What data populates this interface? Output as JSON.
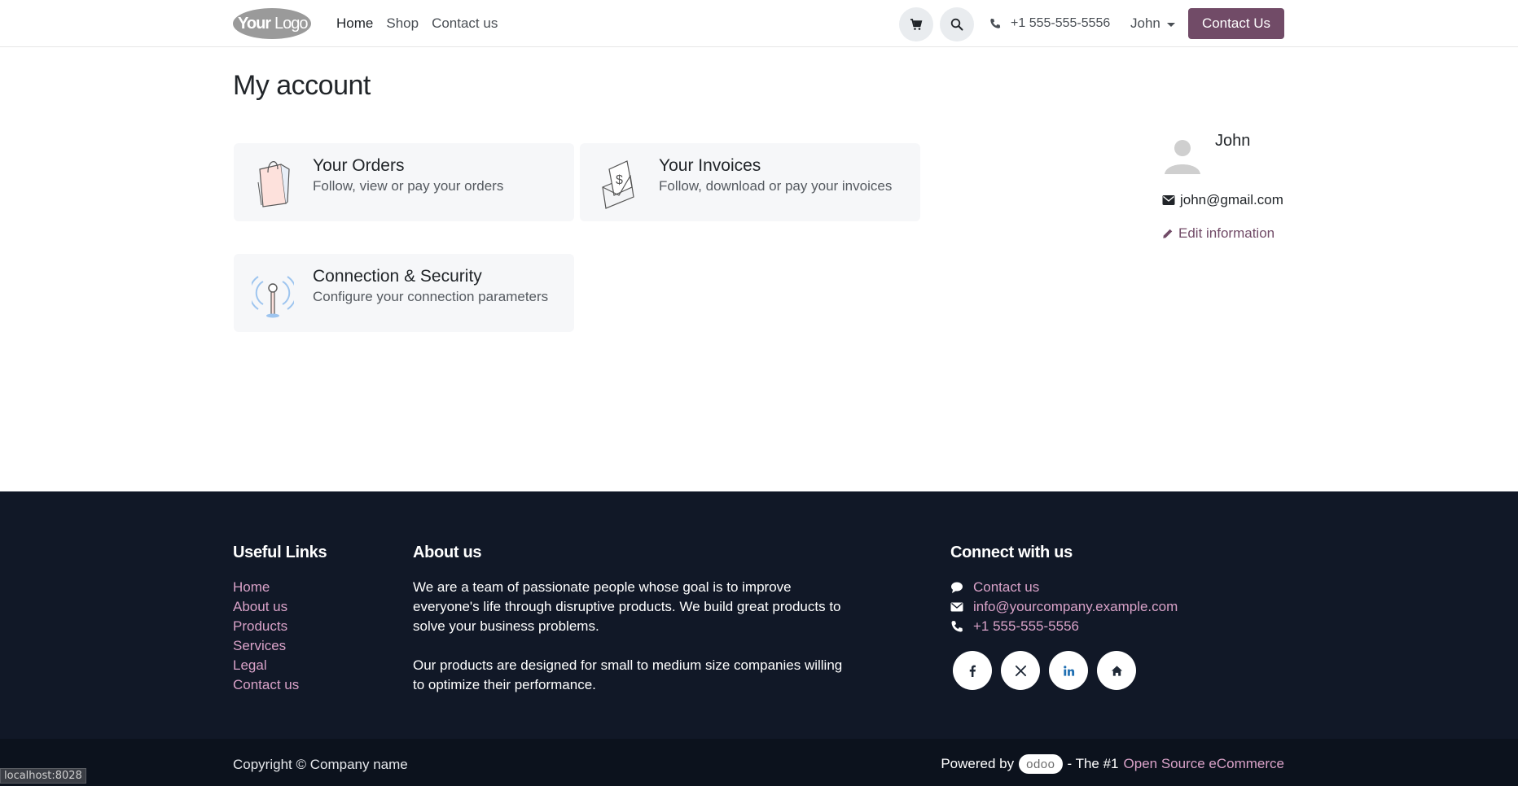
{
  "header": {
    "logo_text": "YourLogo",
    "nav": [
      {
        "label": "Home",
        "active": true
      },
      {
        "label": "Shop",
        "active": false
      },
      {
        "label": "Contact us",
        "active": false
      }
    ],
    "phone": "+1 555-555-5556",
    "user": "John",
    "cta": "Contact Us"
  },
  "main": {
    "title": "My account",
    "cards": [
      {
        "title": "Your Orders",
        "desc": "Follow, view or pay your orders"
      },
      {
        "title": "Your Invoices",
        "desc": "Follow, download or pay your invoices"
      },
      {
        "title": "Connection & Security",
        "desc": "Configure your connection parameters"
      }
    ],
    "profile": {
      "name": "John",
      "email": "john@gmail.com",
      "edit_label": "Edit information"
    }
  },
  "footer": {
    "useful_links_title": "Useful Links",
    "useful_links": [
      "Home",
      "About us",
      "Products",
      "Services",
      "Legal",
      "Contact us"
    ],
    "about_title": "About us",
    "about_p1": "We are a team of passionate people whose goal is to improve everyone's life through disruptive products. We build great products to solve your business problems.",
    "about_p2": "Our products are designed for small to medium size companies willing to optimize their performance.",
    "connect_title": "Connect with us",
    "connect": [
      {
        "icon": "comment-icon",
        "label": "Contact us"
      },
      {
        "icon": "envelope-icon",
        "label": "info@yourcompany.example.com"
      },
      {
        "icon": "phone-icon",
        "label": "+1 555-555-5556"
      }
    ],
    "socials": [
      "facebook-icon",
      "x-twitter-icon",
      "linkedin-icon",
      "home-icon"
    ],
    "copyright": "Copyright © Company name",
    "powered_prefix": "Powered by",
    "odoo": "odoo",
    "powered_mid": "- The #1",
    "powered_link": "Open Source eCommerce"
  },
  "status_url": "localhost:8028",
  "colors": {
    "brand": "#714b67",
    "footer_bg": "#111827",
    "footer_link": "#d9a2c8"
  }
}
